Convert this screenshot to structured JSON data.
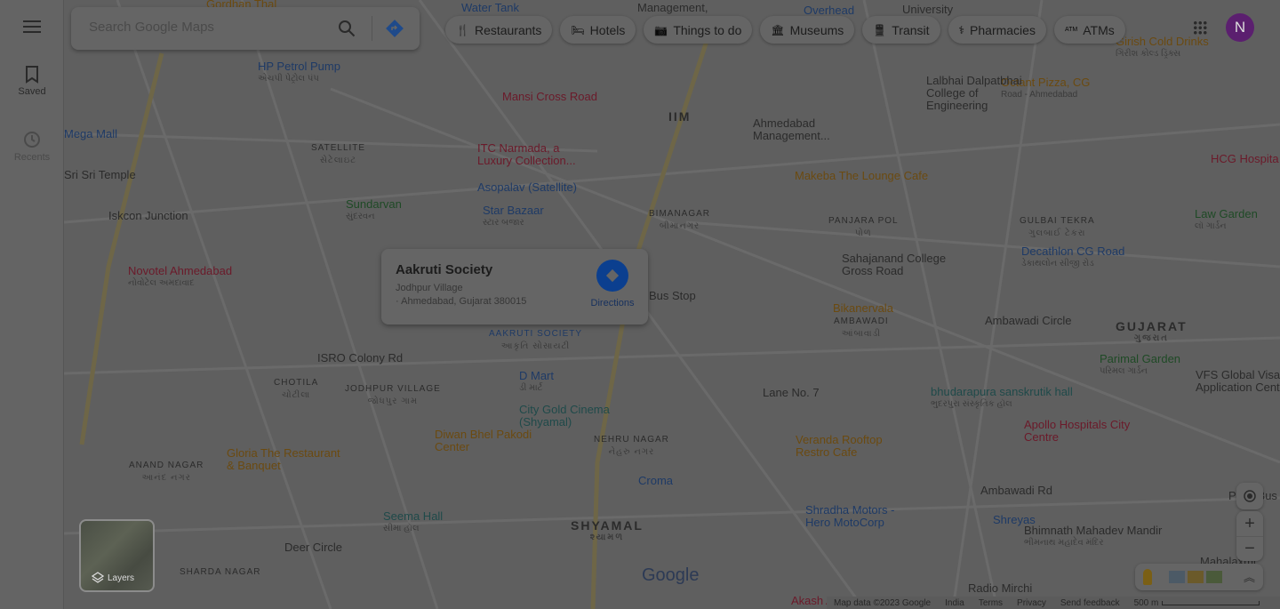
{
  "sidebar": {
    "menu_icon": "hamburger-icon",
    "items": [
      {
        "label": "Saved",
        "icon": "bookmark-icon"
      },
      {
        "label": "Recents",
        "icon": "history-icon"
      }
    ]
  },
  "search": {
    "placeholder": "Search Google Maps",
    "value": ""
  },
  "chips": [
    {
      "label": "Restaurants",
      "icon": "fork-knife-icon"
    },
    {
      "label": "Hotels",
      "icon": "bed-icon"
    },
    {
      "label": "Things to do",
      "icon": "camera-icon"
    },
    {
      "label": "Museums",
      "icon": "museum-icon"
    },
    {
      "label": "Transit",
      "icon": "train-icon"
    },
    {
      "label": "Pharmacies",
      "icon": "pharmacy-icon"
    },
    {
      "label": "ATMs",
      "icon": "atm-icon"
    }
  ],
  "account": {
    "initial": "N",
    "color": "#5b1f6f"
  },
  "card": {
    "title": "Aakruti Society",
    "line1": "Jodhpur Village",
    "line2": "· Ahmedabad, Gujarat 380015",
    "directions": "Directions",
    "accent": "#0b3f8f"
  },
  "layers": {
    "label": "Layers"
  },
  "footer": {
    "map_data": "Map data ©2023 Google",
    "region": "India",
    "terms": "Terms",
    "privacy": "Privacy",
    "feedback": "Send feedback",
    "scale": "500 m"
  },
  "google_logo": "Google",
  "map_labels": [
    {
      "text": "Gordhan Thal",
      "color": "#6b4a10"
    },
    {
      "text": "Water Tank",
      "color": "#1e3a66"
    },
    {
      "text": "Management,",
      "color": "#2b2b2b"
    },
    {
      "text": "Overhead",
      "color": "#1e3a66"
    },
    {
      "text": "University",
      "color": "#2b2b2b"
    },
    {
      "text": "Girish Cold Drinks",
      "sub": "ગિરીશ કોલ્ડ ડ્રિંક્સ",
      "color": "#6b4a10"
    },
    {
      "text": "HP Petrol Pump",
      "sub": "એચપી પેટ્રોલ પંપ",
      "color": "#1e3a66"
    },
    {
      "text": "Mansi Cross Road",
      "color": "#6b1a2a"
    },
    {
      "text": "Octant Pizza, CG",
      "sub": "Road - Ahmedabad",
      "color": "#6b4a10"
    },
    {
      "text": "Lalbhai Dalpatbhai College of Engineering",
      "color": "#2b2b2b"
    },
    {
      "text": "Mega Mall",
      "color": "#1e3a66"
    },
    {
      "text": "IIM",
      "color": "#2b2b2b"
    },
    {
      "text": "Ahmedabad Management...",
      "color": "#2b2b2b"
    },
    {
      "text": "SATELLITE",
      "sub": "સેટેલાઇટ",
      "color": "#2b2b2b"
    },
    {
      "text": "ITC Narmada, a Luxury Collection...",
      "color": "#6b1a2a"
    },
    {
      "text": "HCG Hospita",
      "color": "#6b1a2a"
    },
    {
      "text": "Sri Sri Temple",
      "color": "#2b2b2b"
    },
    {
      "text": "Makeba The Lounge Cafe",
      "color": "#6b4a10"
    },
    {
      "text": "Asopalav (Satellite)",
      "color": "#1e3a66"
    },
    {
      "text": "Sundarvan",
      "sub": "સુંદરવન",
      "color": "#1f4a26"
    },
    {
      "text": "Star Bazaar",
      "sub": "સ્ટાર બજાર",
      "color": "#1e3a66"
    },
    {
      "text": "BIMANAGAR",
      "sub": "બીમાનગર",
      "color": "#2b2b2b"
    },
    {
      "text": "PANJARA POL",
      "sub": "પોળ",
      "color": "#2b2b2b"
    },
    {
      "text": "GULBAI TEKRA",
      "sub": "ગુલબાઈ ટેકરા",
      "color": "#2b2b2b"
    },
    {
      "text": "Law Garden",
      "sub": "લૉ ગાર્ડન",
      "color": "#1f4a26"
    },
    {
      "text": "Iskcon Junction",
      "color": "#2b2b2b"
    },
    {
      "text": "Decathlon CG Road",
      "sub": "ડેકાથલોન સીજી રોડ",
      "color": "#1e3a66"
    },
    {
      "text": "Novotel Ahmedabad",
      "sub": "નોવોટેલ અમદાવાદ",
      "color": "#6b1a2a"
    },
    {
      "text": "Sahajanand College Gross Road",
      "color": "#2b2b2b"
    },
    {
      "text": "Bus Stop",
      "color": "#2b2b2b"
    },
    {
      "text": "Bikanervala",
      "color": "#6b4a10"
    },
    {
      "text": "AMBAWADI",
      "sub": "આંબાવાડી",
      "color": "#2b2b2b"
    },
    {
      "text": "GUJARAT",
      "sub": "ગુજરાત",
      "color": "#2b2b2b"
    },
    {
      "text": "AAKRUTI SOCIETY",
      "sub": "આકૃતિ સોસાયટી",
      "color": "#1e3a66"
    },
    {
      "text": "ISRO Colony Rd",
      "color": "#2b2b2b"
    },
    {
      "text": "Parimal Garden",
      "sub": "પરિમલ ગાર્ડન",
      "color": "#1f4a26"
    },
    {
      "text": "VFS Global Visa Application Cent",
      "color": "#2b2b2b"
    },
    {
      "text": "D Mart",
      "sub": "ડી માર્ટ",
      "color": "#1e3a66"
    },
    {
      "text": "CHOTILA",
      "sub": "ચોટીલા",
      "color": "#2b2b2b"
    },
    {
      "text": "JODHPUR VILLAGE",
      "sub": "જોધપુર ગામ",
      "color": "#2b2b2b"
    },
    {
      "text": "bhudarapura sanskrutik hall",
      "sub": "ભુદરપુરા સંસ્કૃતિક હૉલ",
      "color": "#1f4a4a"
    },
    {
      "text": "City Gold Cinema (Shyamal)",
      "color": "#1f4a4a"
    },
    {
      "text": "Apollo Hospitals City Centre",
      "color": "#6b1a2a"
    },
    {
      "text": "Diwan Bhel Pakodi Center",
      "color": "#6b4a10"
    },
    {
      "text": "NEHRU NAGAR",
      "sub": "નેહરુ નગર",
      "color": "#2b2b2b"
    },
    {
      "text": "Veranda Rooftop Restro Cafe",
      "color": "#6b4a10"
    },
    {
      "text": "Gloria The Restaurant & Banquet",
      "color": "#6b4a10"
    },
    {
      "text": "ANAND NAGAR",
      "sub": "આનંદ નગર",
      "color": "#2b2b2b"
    },
    {
      "text": "Croma",
      "color": "#1e3a66"
    },
    {
      "text": "Paldi Bus Stati",
      "color": "#2b2b2b"
    },
    {
      "text": "Seema Hall",
      "sub": "સીમા હૉલ",
      "color": "#1f4a4a"
    },
    {
      "text": "SHYAMAL",
      "sub": "શ્યામળ",
      "color": "#2b2b2b"
    },
    {
      "text": "Shradha Motors - Hero MotoCorp",
      "color": "#1e3a66"
    },
    {
      "text": "Shreyas",
      "color": "#1e3a66"
    },
    {
      "text": "Bhimnath Mahadev Mandir",
      "sub": "ભીમનાથ મહાદેવ મંદિર",
      "color": "#2b2b2b"
    },
    {
      "text": "Deer Circle",
      "color": "#2b2b2b"
    },
    {
      "text": "SHARDA NAGAR",
      "color": "#2b2b2b"
    },
    {
      "text": "Radio Mirchi",
      "color": "#2b2b2b"
    },
    {
      "text": "Akash Amar",
      "color": "#6b1a2a"
    },
    {
      "text": "Mahalaxmi",
      "color": "#2b2b2b"
    },
    {
      "text": "Ambawadi Rd",
      "color": "#2b2b2b"
    },
    {
      "text": "Lane No. 7",
      "color": "#2b2b2b"
    },
    {
      "text": "Ambawadi Circle",
      "color": "#2b2b2b"
    }
  ]
}
